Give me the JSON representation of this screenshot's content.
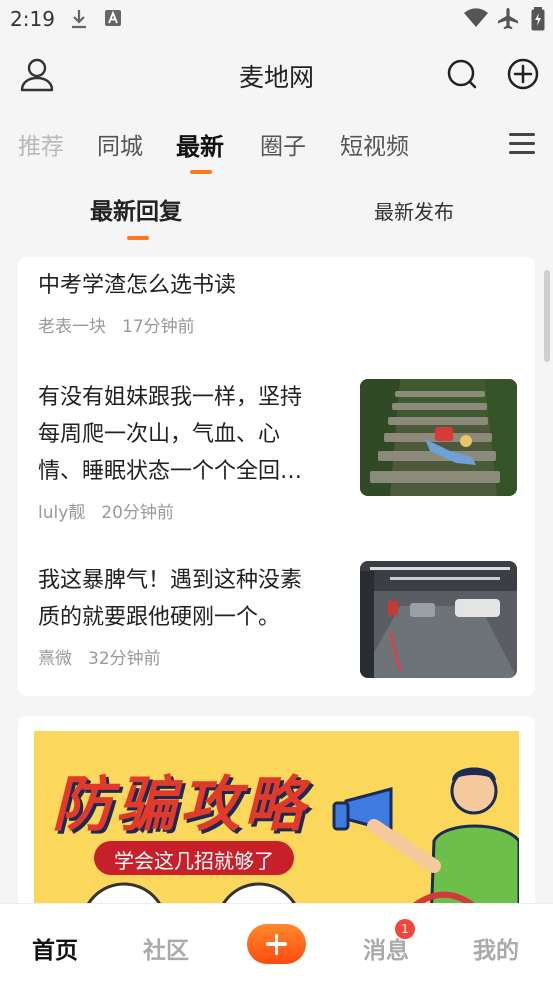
{
  "status_bar": {
    "time": "2:19"
  },
  "header": {
    "title": "麦地网"
  },
  "tabs": [
    {
      "label": "推荐"
    },
    {
      "label": "同城"
    },
    {
      "label": "最新"
    },
    {
      "label": "圈子"
    },
    {
      "label": "短视频"
    }
  ],
  "subtabs": [
    {
      "label": "最新回复"
    },
    {
      "label": "最新发布"
    }
  ],
  "posts": [
    {
      "title": "中考学渣怎么选书读",
      "author": "老表一块",
      "time": "17分钟前"
    },
    {
      "title_lines": [
        "有没有姐妹跟我一样，坚持",
        "每周爬一次山，气血、心",
        "情、睡眠状态一个个全回…"
      ],
      "author": "luly靓",
      "time": "20分钟前"
    },
    {
      "title_lines": [
        "我这暴脾气！遇到这种没素",
        "质的就要跟他硬刚一个。"
      ],
      "author": "熹微",
      "time": "32分钟前"
    }
  ],
  "banner": {
    "headline": "防骗攻略",
    "subline": "学会这几招就够了"
  },
  "bottom_nav": [
    {
      "label": "首页"
    },
    {
      "label": "社区"
    },
    {
      "label": "消息"
    },
    {
      "label": "我的"
    }
  ],
  "messages_badge": "1",
  "colors": {
    "accent": "#ff7a1a",
    "badge": "#f2453d",
    "banner_bg": "#fbd85c",
    "banner_text": "#e03a2b"
  }
}
